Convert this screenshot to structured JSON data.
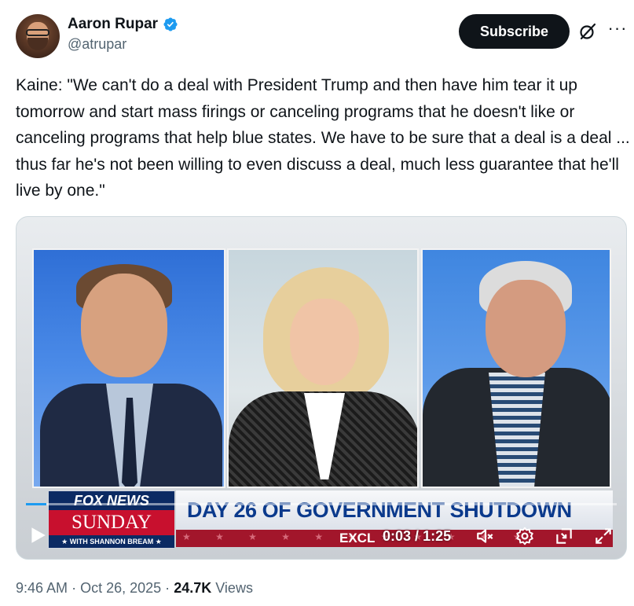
{
  "author": {
    "display_name": "Aaron Rupar",
    "handle": "@atrupar",
    "verified_icon": "verified-badge-icon",
    "badge_color": "#1d9bf0"
  },
  "header": {
    "subscribe_label": "Subscribe",
    "grok_icon": "grok-icon",
    "more_icon": "more-icon",
    "more_glyph": "···"
  },
  "tweet": {
    "text": "Kaine: \"We can't do a deal with President Trump and then have him tear it up tomorrow and start mass firings or canceling programs that he doesn't like or canceling programs that help blue states. We have to be sure that a deal is a deal ... thus far he's not been willing to even discuss a deal, much less guarantee that he'll live by one.\""
  },
  "video": {
    "network_logo_top": "FOX NEWS",
    "network_logo_mid": "SUNDAY",
    "network_logo_bottom": "★ WITH SHANNON BREAM ★",
    "headline": "DAY 26 OF GOVERNMENT SHUTDOWN",
    "ticker_partial": "EXCL",
    "ticker_stars": "★ ★ ★ ★ ★ ★ ★ ★ ★ ★ ★",
    "current_time": "0:03",
    "separator": "/",
    "duration": "1:25",
    "progress_fraction": 0.035,
    "progress_color": "#1d9bf0"
  },
  "meta": {
    "time": "9:46 AM",
    "dot1": "·",
    "date": "Oct 26, 2025",
    "dot2": "·",
    "views_count": "24.7K",
    "views_label": "Views"
  }
}
